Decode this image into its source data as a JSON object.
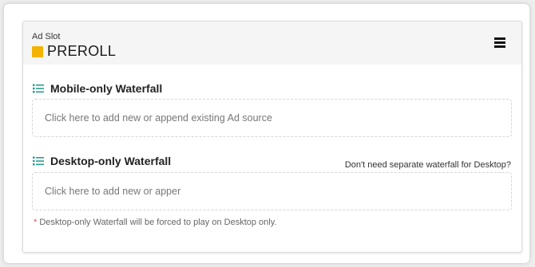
{
  "ad_slot": {
    "label": "Ad Slot",
    "name": "PREROLL",
    "color": "#f5b301"
  },
  "menu": {
    "icon": "hamburger-menu-icon"
  },
  "mobile": {
    "title": "Mobile-only Waterfall",
    "icon": "list-icon",
    "placeholder": "Click here to add new or append existing Ad source"
  },
  "desktop": {
    "title": "Desktop-only Waterfall",
    "icon": "list-icon",
    "link": "Don't need separate waterfall for Desktop?",
    "placeholder": "Click here to add new or apper",
    "note_star": "*",
    "note": "Desktop-only Waterfall will be forced to play on Desktop only."
  },
  "colors": {
    "icon": "#2a9d8f",
    "header_bg": "#f5f5f5"
  }
}
